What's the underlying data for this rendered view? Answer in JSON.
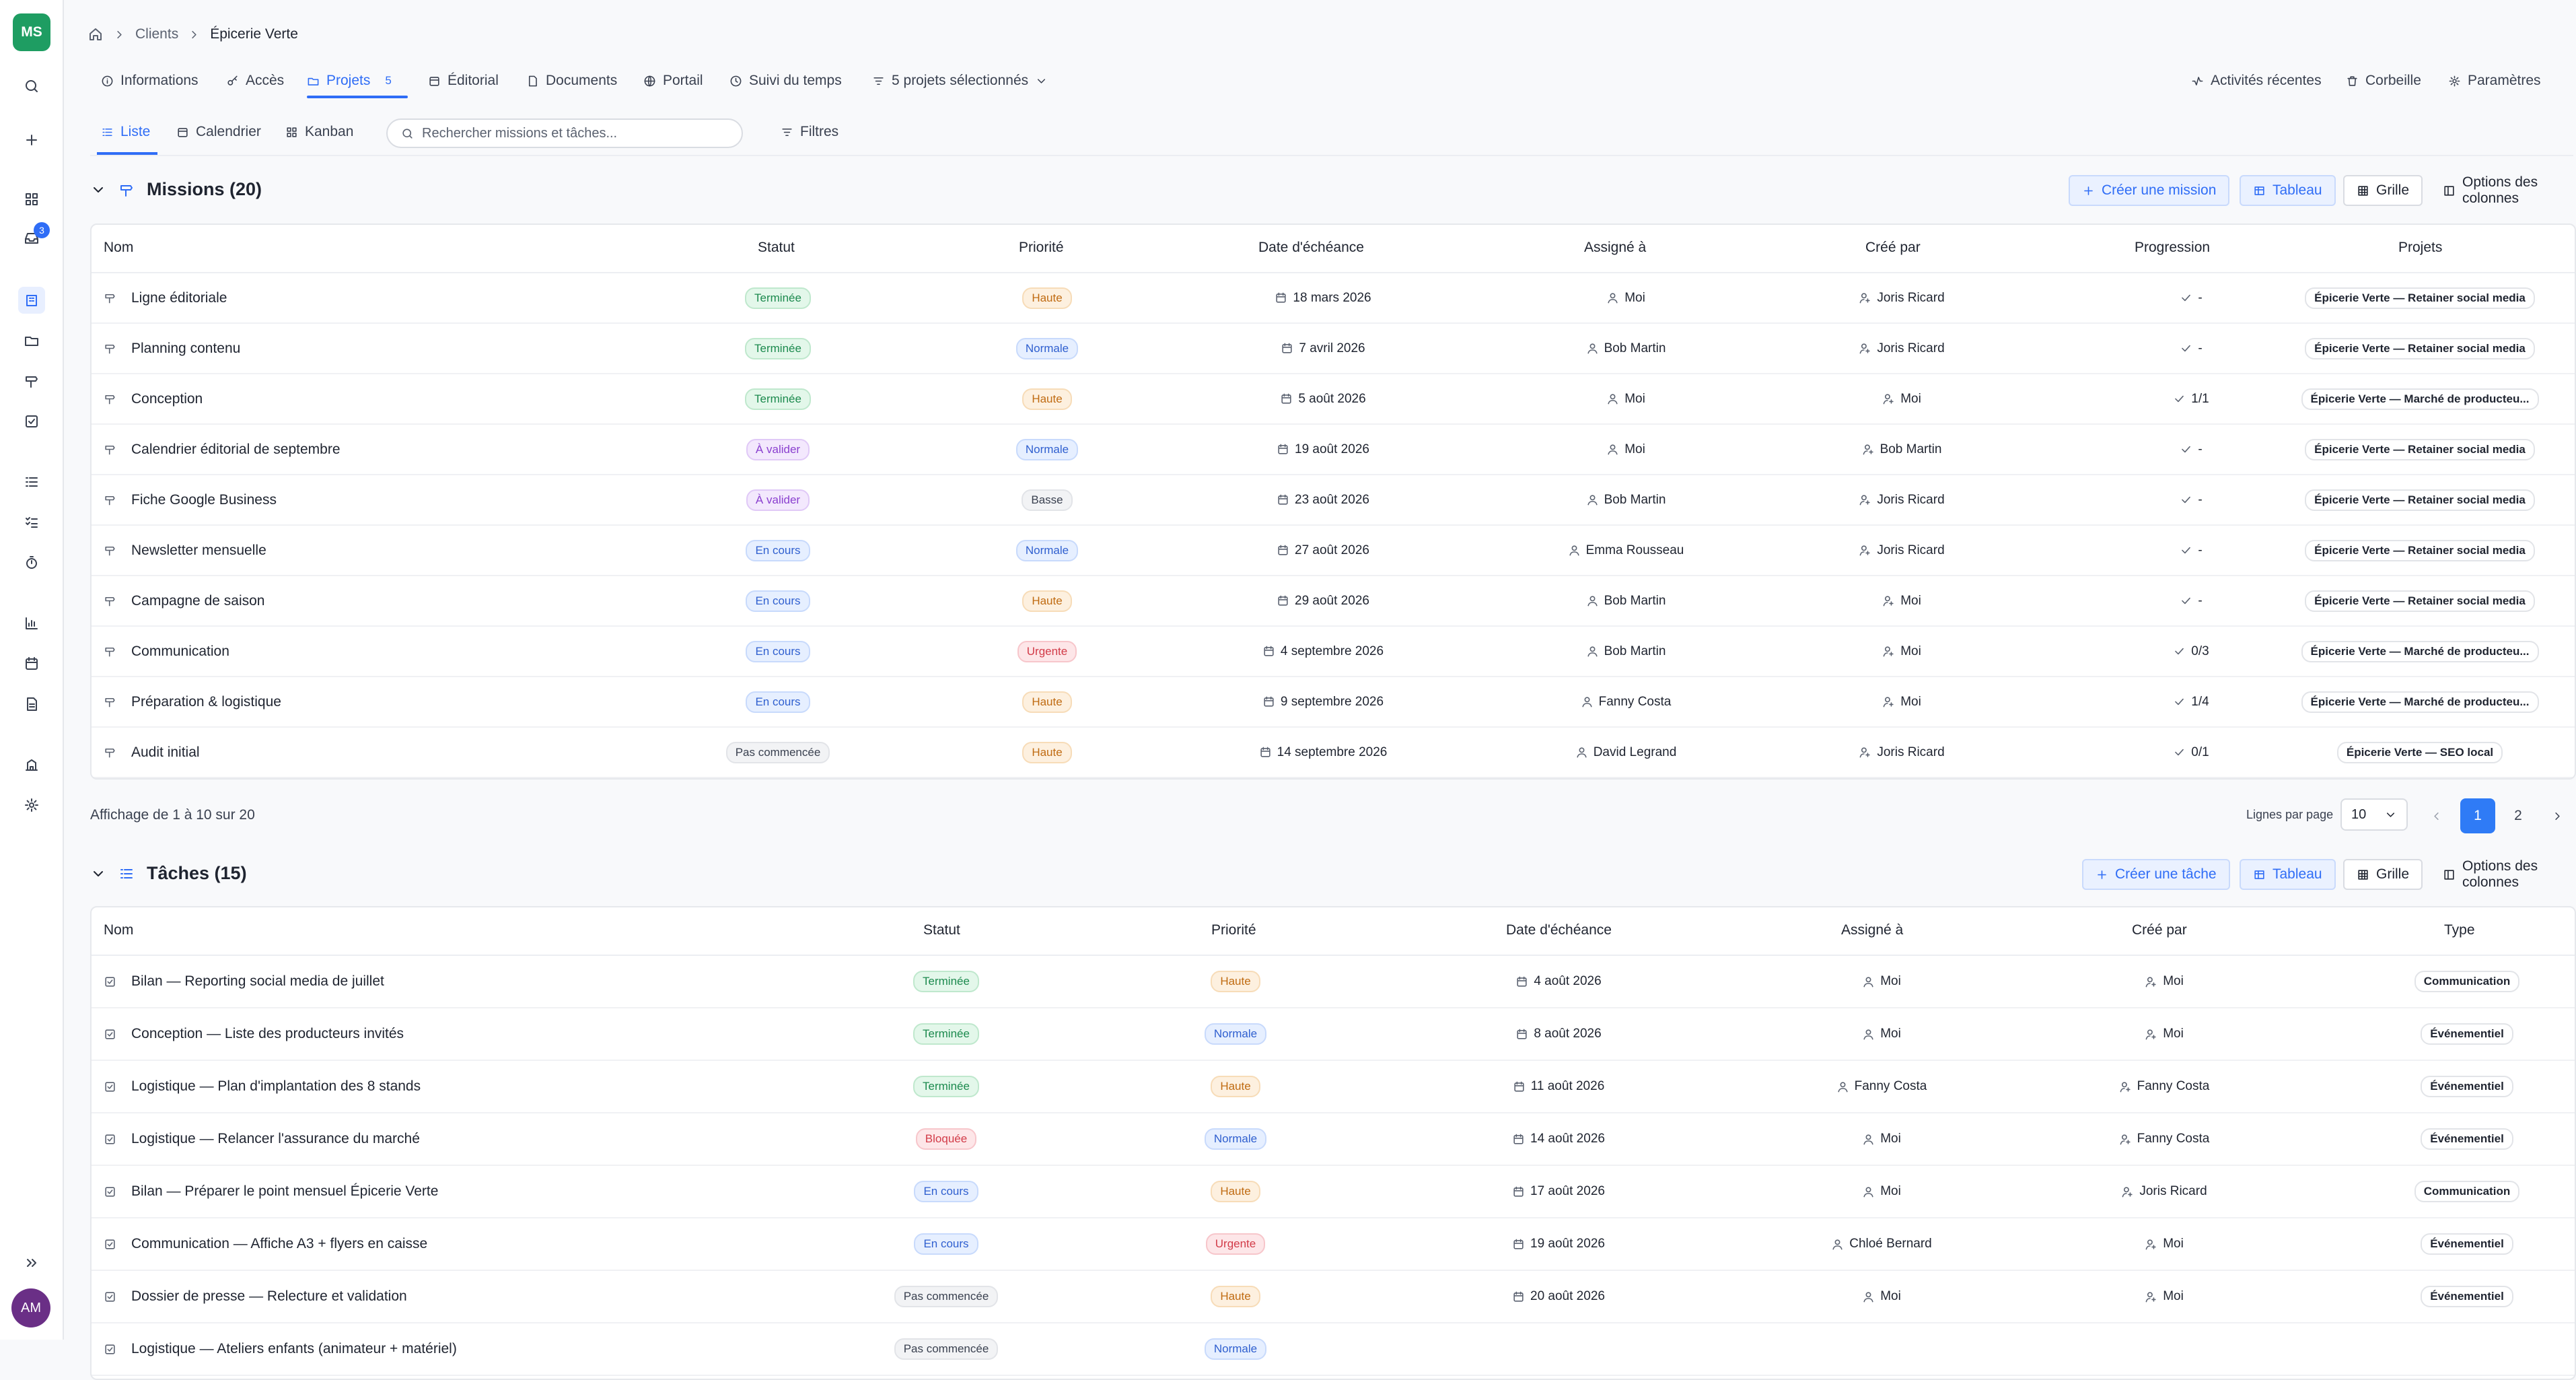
{
  "user": {
    "workspace_initials": "MS",
    "avatar_initials": "AM",
    "notification_count": "3"
  },
  "breadcrumb": {
    "root": "Clients",
    "current": "Épicerie Verte"
  },
  "tabs": {
    "informations": "Informations",
    "acces": "Accès",
    "projets": "Projets",
    "projets_count": "5",
    "editorial": "Éditorial",
    "documents": "Documents",
    "portail": "Portail",
    "suivi": "Suivi du temps",
    "filter_projects": "5 projets sélectionnés",
    "activites": "Activités récentes",
    "corbeille": "Corbeille",
    "parametres": "Paramètres"
  },
  "views": {
    "liste": "Liste",
    "calendrier": "Calendrier",
    "kanban": "Kanban",
    "search_placeholder": "Rechercher missions et tâches...",
    "filtres": "Filtres"
  },
  "missions": {
    "title": "Missions (20)",
    "create": "Créer une mission",
    "tableau": "Tableau",
    "grille": "Grille",
    "options": "Options des colonnes",
    "columns": [
      "Nom",
      "Statut",
      "Priorité",
      "Date d'échéance",
      "Assigné à",
      "Créé par",
      "Progression",
      "Projets"
    ],
    "rows": [
      {
        "name": "Ligne éditoriale",
        "status": "Terminée",
        "status_color": "green",
        "priority": "Haute",
        "priority_color": "orange",
        "due": "18 mars 2026",
        "assignee": "Moi",
        "creator": "Joris Ricard",
        "progress": "-",
        "project": "Épicerie Verte — Retainer social media"
      },
      {
        "name": "Planning contenu",
        "status": "Terminée",
        "status_color": "green",
        "priority": "Normale",
        "priority_color": "blue",
        "due": "7 avril 2026",
        "assignee": "Bob Martin",
        "creator": "Joris Ricard",
        "progress": "-",
        "project": "Épicerie Verte — Retainer social media"
      },
      {
        "name": "Conception",
        "status": "Terminée",
        "status_color": "green",
        "priority": "Haute",
        "priority_color": "orange",
        "due": "5 août 2026",
        "assignee": "Moi",
        "creator": "Moi",
        "progress": "1/1",
        "project": "Épicerie Verte — Marché de producteu..."
      },
      {
        "name": "Calendrier éditorial de septembre",
        "status": "À valider",
        "status_color": "purple",
        "priority": "Normale",
        "priority_color": "blue",
        "due": "19 août 2026",
        "assignee": "Moi",
        "creator": "Bob Martin",
        "progress": "-",
        "project": "Épicerie Verte — Retainer social media"
      },
      {
        "name": "Fiche Google Business",
        "status": "À valider",
        "status_color": "purple",
        "priority": "Basse",
        "priority_color": "gray",
        "due": "23 août 2026",
        "assignee": "Bob Martin",
        "creator": "Joris Ricard",
        "progress": "-",
        "project": "Épicerie Verte — Retainer social media"
      },
      {
        "name": "Newsletter mensuelle",
        "status": "En cours",
        "status_color": "blue",
        "priority": "Normale",
        "priority_color": "blue",
        "due": "27 août 2026",
        "assignee": "Emma Rousseau",
        "creator": "Joris Ricard",
        "progress": "-",
        "project": "Épicerie Verte — Retainer social media"
      },
      {
        "name": "Campagne de saison",
        "status": "En cours",
        "status_color": "blue",
        "priority": "Haute",
        "priority_color": "orange",
        "due": "29 août 2026",
        "assignee": "Bob Martin",
        "creator": "Moi",
        "progress": "-",
        "project": "Épicerie Verte — Retainer social media"
      },
      {
        "name": "Communication",
        "status": "En cours",
        "status_color": "blue",
        "priority": "Urgente",
        "priority_color": "red",
        "due": "4 septembre 2026",
        "assignee": "Bob Martin",
        "creator": "Moi",
        "progress": "0/3",
        "project": "Épicerie Verte — Marché de producteu..."
      },
      {
        "name": "Préparation & logistique",
        "status": "En cours",
        "status_color": "blue",
        "priority": "Haute",
        "priority_color": "orange",
        "due": "9 septembre 2026",
        "assignee": "Fanny Costa",
        "creator": "Moi",
        "progress": "1/4",
        "project": "Épicerie Verte — Marché de producteu..."
      },
      {
        "name": "Audit initial",
        "status": "Pas commencée",
        "status_color": "gray",
        "priority": "Haute",
        "priority_color": "orange",
        "due": "14 septembre 2026",
        "assignee": "David Legrand",
        "creator": "Joris Ricard",
        "progress": "0/1",
        "project": "Épicerie Verte — SEO local"
      }
    ],
    "pagination": {
      "info": "Affichage de 1 à 10 sur 20",
      "rows_per_page_label": "Lignes par page",
      "rows_per_page": "10",
      "pages": [
        "1",
        "2"
      ],
      "current_page": "1"
    }
  },
  "tasks": {
    "title": "Tâches (15)",
    "create": "Créer une tâche",
    "tableau": "Tableau",
    "grille": "Grille",
    "options": "Options des colonnes",
    "columns": [
      "Nom",
      "Statut",
      "Priorité",
      "Date d'échéance",
      "Assigné à",
      "Créé par",
      "Type"
    ],
    "rows": [
      {
        "name": "Bilan — Reporting social media de juillet",
        "status": "Terminée",
        "status_color": "green",
        "priority": "Haute",
        "priority_color": "orange",
        "due": "4 août 2026",
        "assignee": "Moi",
        "creator": "Moi",
        "type": "Communication"
      },
      {
        "name": "Conception — Liste des producteurs invités",
        "status": "Terminée",
        "status_color": "green",
        "priority": "Normale",
        "priority_color": "blue",
        "due": "8 août 2026",
        "assignee": "Moi",
        "creator": "Moi",
        "type": "Événementiel"
      },
      {
        "name": "Logistique — Plan d'implantation des 8 stands",
        "status": "Terminée",
        "status_color": "green",
        "priority": "Haute",
        "priority_color": "orange",
        "due": "11 août 2026",
        "assignee": "Fanny Costa",
        "creator": "Fanny Costa",
        "type": "Événementiel"
      },
      {
        "name": "Logistique — Relancer l'assurance du marché",
        "status": "Bloquée",
        "status_color": "red",
        "priority": "Normale",
        "priority_color": "blue",
        "due": "14 août 2026",
        "assignee": "Moi",
        "creator": "Fanny Costa",
        "type": "Événementiel"
      },
      {
        "name": "Bilan — Préparer le point mensuel Épicerie Verte",
        "status": "En cours",
        "status_color": "blue",
        "priority": "Haute",
        "priority_color": "orange",
        "due": "17 août 2026",
        "assignee": "Moi",
        "creator": "Joris Ricard",
        "type": "Communication"
      },
      {
        "name": "Communication — Affiche A3 + flyers en caisse",
        "status": "En cours",
        "status_color": "blue",
        "priority": "Urgente",
        "priority_color": "red",
        "due": "19 août 2026",
        "assignee": "Chloé Bernard",
        "creator": "Moi",
        "type": "Événementiel"
      },
      {
        "name": "Dossier de presse — Relecture et validation",
        "status": "Pas commencée",
        "status_color": "gray",
        "priority": "Haute",
        "priority_color": "orange",
        "due": "20 août 2026",
        "assignee": "Moi",
        "creator": "Moi",
        "type": "Événementiel"
      },
      {
        "name": "Logistique — Ateliers enfants (animateur + matériel)",
        "status": "Pas commencée",
        "status_color": "gray",
        "priority": "Normale",
        "priority_color": "blue",
        "due": "",
        "assignee": "",
        "creator": "",
        "type": ""
      }
    ]
  }
}
